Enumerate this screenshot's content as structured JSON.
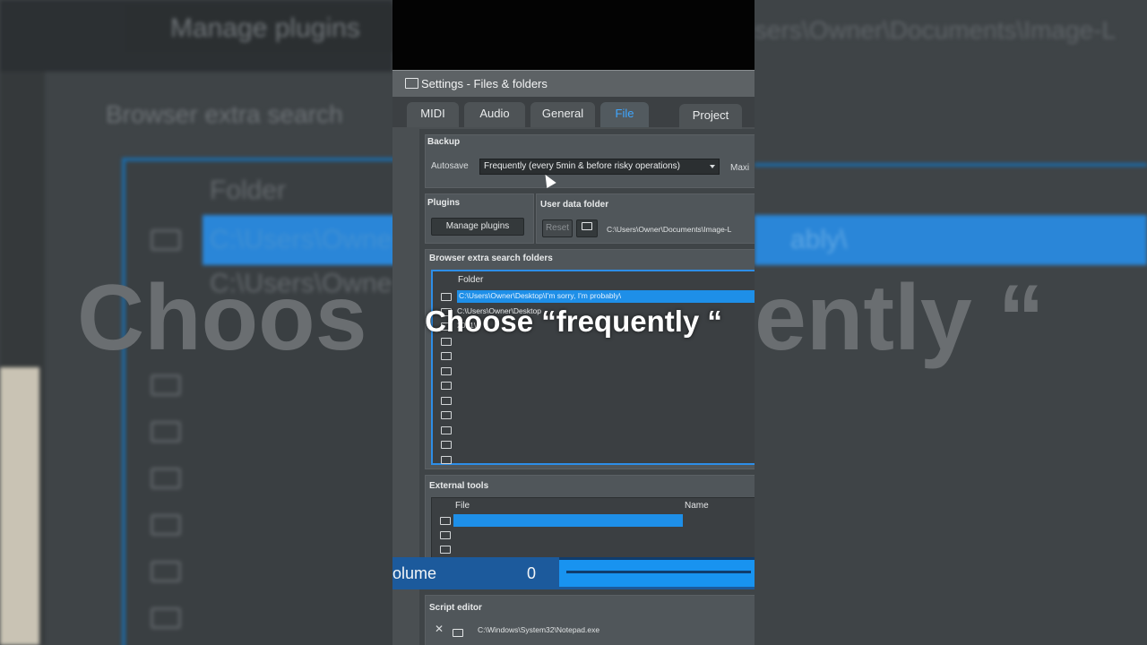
{
  "background": {
    "left_manage_plugins": "Manage plugins",
    "left_browser_extra": "Browser extra search",
    "left_folder_header": "Folder",
    "left_row1": "C:\\Users\\Owne",
    "left_row2": "C:\\Users\\Owne",
    "right_path": "sers\\Owner\\Documents\\Image-L",
    "right_row": "ably\\",
    "big_left": "Choos",
    "big_right": "ently “"
  },
  "window": {
    "title": "Settings - Files & folders",
    "tabs": [
      {
        "label": "MIDI"
      },
      {
        "label": "Audio"
      },
      {
        "label": "General"
      },
      {
        "label": "File",
        "active": true
      },
      {
        "label": "Project"
      }
    ]
  },
  "backup": {
    "header": "Backup",
    "autosave_label": "Autosave",
    "autosave_value": "Frequently (every 5min & before risky operations)",
    "max_label": "Maxi"
  },
  "plugins": {
    "header": "Plugins",
    "manage_button": "Manage plugins"
  },
  "user_data": {
    "header": "User data folder",
    "reset_button": "Reset",
    "path": "C:\\Users\\Owner\\Documents\\Image-L"
  },
  "browser_folders": {
    "header": "Browser extra search folders",
    "column": "Folder",
    "rows": [
      "C:\\Users\\Owner\\Desktop\\I'm sorry, I'm probably\\",
      "C:\\Users\\Owner\\Desktop",
      "2021\\",
      "",
      "",
      "",
      "",
      "",
      "",
      "",
      "",
      ""
    ]
  },
  "external_tools": {
    "header": "External tools",
    "col_file": "File",
    "col_name": "Name"
  },
  "volume": {
    "label": "olume",
    "value": "0"
  },
  "script_editor": {
    "header": "Script editor",
    "path": "C:\\Windows\\System32\\Notepad.exe"
  },
  "caption": "Choose “frequently “",
  "colors": {
    "accent": "#1e8fe8",
    "active_tab": "#3fa6ff"
  }
}
